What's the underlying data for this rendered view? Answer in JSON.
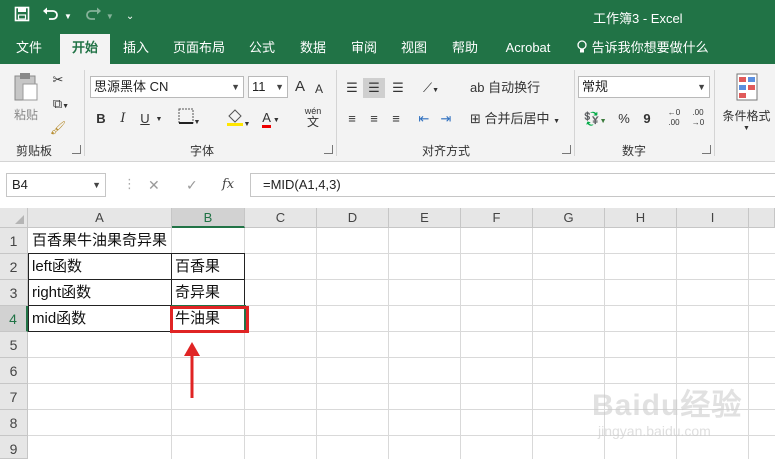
{
  "window": {
    "title": "工作簿3  -  Excel"
  },
  "qat": {
    "save_icon": "save-icon",
    "undo_icon": "undo-icon",
    "redo_icon": "redo-icon",
    "customize_icon": "chevron-down-icon"
  },
  "tabs": [
    "文件",
    "开始",
    "插入",
    "页面布局",
    "公式",
    "数据",
    "审阅",
    "视图",
    "帮助",
    "Acrobat",
    "告诉我你想要做什么"
  ],
  "ribbon": {
    "clipboard": {
      "label": "剪贴板",
      "paste": "粘贴"
    },
    "font": {
      "label": "字体",
      "name": "思源黑体 CN",
      "size": "11",
      "bold": "B",
      "italic": "I",
      "underline": "U",
      "grow": "A",
      "shrink": "A",
      "font_color": "A",
      "phonetic": "wén"
    },
    "alignment": {
      "label": "对齐方式",
      "wrap": "自动换行",
      "merge": "合并后居中"
    },
    "number": {
      "label": "数字",
      "format": "常规",
      "percent": "%",
      "comma": "9"
    },
    "styles": {
      "cond_format": "条件格式"
    }
  },
  "formula_bar": {
    "name_box": "B4",
    "cancel": "✕",
    "enter": "✓",
    "fx": "fx",
    "formula": "=MID(A1,4,3)"
  },
  "sheet": {
    "columns": [
      "A",
      "B",
      "C",
      "D",
      "E",
      "F",
      "G",
      "H",
      "I"
    ],
    "rows": [
      "1",
      "2",
      "3",
      "4",
      "5",
      "6",
      "7",
      "8",
      "9"
    ],
    "cells": {
      "A1": "百香果牛油果奇异果",
      "A2": "left函数",
      "B2": "百香果",
      "A3": "right函数",
      "B3": "奇异果",
      "A4": "mid函数",
      "B4": "牛油果"
    },
    "selected_cell": "B4"
  },
  "watermark": {
    "text": "Baidu经验",
    "url": "jingyan.baidu.com"
  },
  "colors": {
    "excel_green": "#217346",
    "highlight_red": "#e02424"
  }
}
